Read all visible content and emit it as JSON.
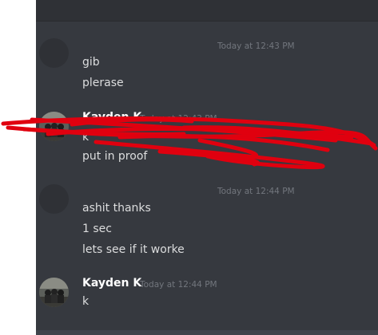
{
  "messages": [
    {
      "group": 1,
      "timestamp": "Today at 12:43 PM",
      "lines": [
        "gib",
        "plerase"
      ]
    },
    {
      "group": 2,
      "username": "Kayden K",
      "timestamp": "Today at 12:43 PM",
      "lines": [
        "put in proof"
      ],
      "redacted_line": "k"
    },
    {
      "group": 3,
      "timestamp": "Today at 12:44 PM",
      "lines": [
        "ashit thanks",
        "1 sec",
        "lets see if it worke"
      ]
    },
    {
      "group": 4,
      "username": "Kayden K",
      "timestamp": "Today at 12:44 PM",
      "lines": [
        "k"
      ]
    }
  ],
  "colors": {
    "background": "#36393f",
    "text": "#dcddde",
    "timestamp": "#72767d",
    "username": "#ffffff",
    "scribble": "#e0000f"
  },
  "icons": {
    "avatar_kayden": "user-avatar-photo",
    "avatar_other": "user-avatar-placeholder",
    "redaction": "red-scribble-overlay"
  }
}
